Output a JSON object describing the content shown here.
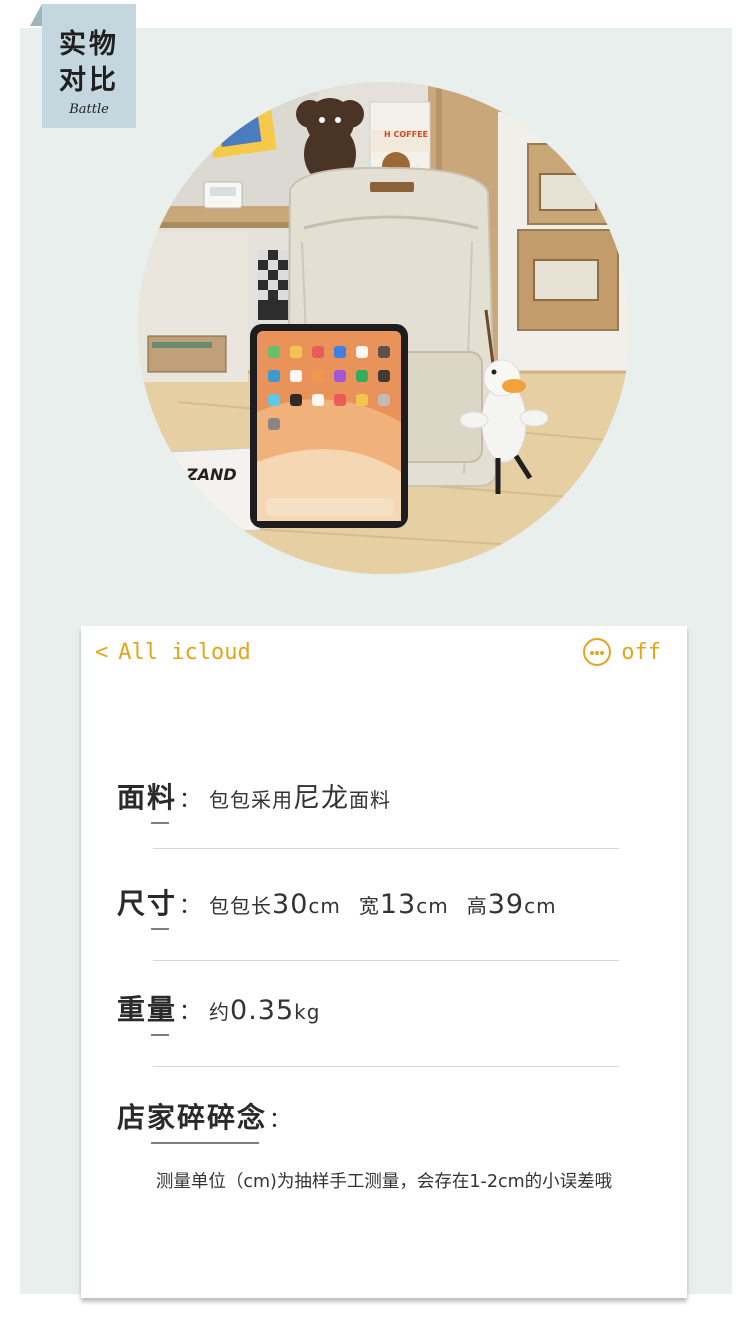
{
  "badge": {
    "line1": "实物",
    "line2": "对比",
    "sub": "Battle"
  },
  "photo": {
    "subject": "backpack-with-tablet",
    "coffee_text": "H COFFEE",
    "book_text": "ZAND"
  },
  "card": {
    "nav": {
      "back_label": "All icloud",
      "back_chevron": "<",
      "right_label": "off",
      "right_icon": "more-dots-icon"
    },
    "specs": [
      {
        "label": "面料",
        "colon": "：",
        "value_parts": [
          "包包采用",
          "尼龙",
          "面料"
        ]
      },
      {
        "label": "尺寸",
        "colon": "：",
        "value_parts": [
          "包包长",
          "30",
          "cm",
          "宽",
          "13",
          "cm",
          "高",
          "39",
          "cm"
        ]
      },
      {
        "label": "重量",
        "colon": "：",
        "value_parts": [
          "约",
          "0.35",
          "kg"
        ]
      },
      {
        "label": "店家碎碎念",
        "colon": "："
      }
    ],
    "note": "测量单位（cm)为抽样手工测量，会存在1-2cm的小误差哦"
  },
  "colors": {
    "accent": "#e4a51b",
    "panel_bg": "#e8efec",
    "badge_bg": "#c4d7de",
    "card_bg": "#ffffff"
  }
}
